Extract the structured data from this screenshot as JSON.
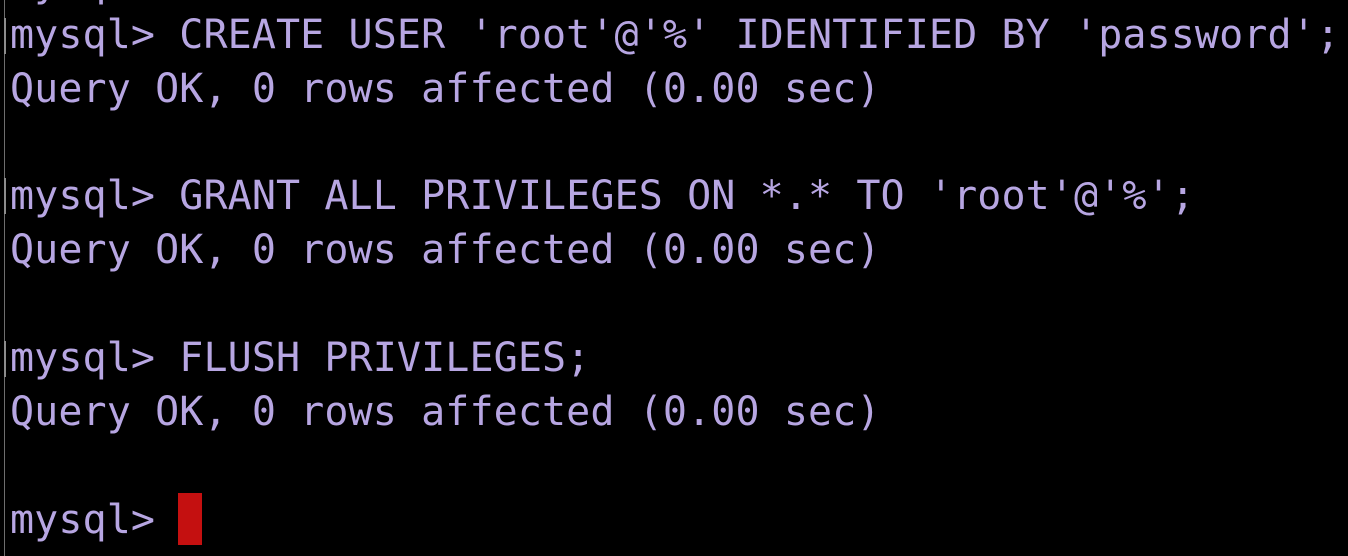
{
  "terminal": {
    "clipped_previous_line": "mysql> ...",
    "lines": [
      "mysql> CREATE USER 'root'@'%' IDENTIFIED BY 'password';",
      "Query OK, 0 rows affected (0.00 sec)",
      "",
      "mysql> GRANT ALL PRIVILEGES ON *.* TO 'root'@'%';",
      "Query OK, 0 rows affected (0.00 sec)",
      "",
      "mysql> FLUSH PRIVILEGES;",
      "Query OK, 0 rows affected (0.00 sec)",
      "",
      "mysql> "
    ],
    "colors": {
      "background": "#000000",
      "text": "#b7a6e2",
      "cursor": "#c41010"
    }
  }
}
